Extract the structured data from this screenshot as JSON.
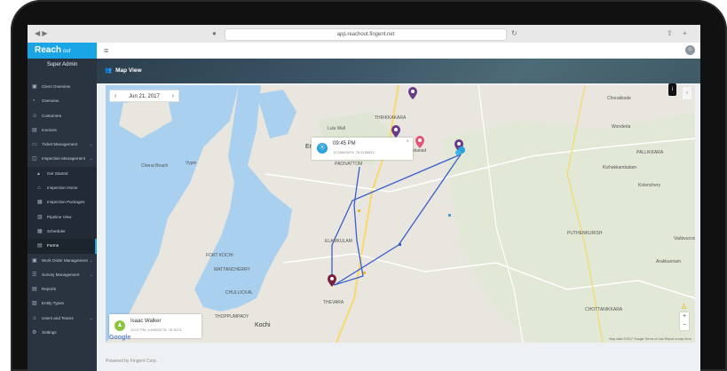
{
  "browser": {
    "url": "app.reachout.fingent.net"
  },
  "sidebar": {
    "logo": "Reach",
    "logo_sub": "out",
    "user": "Super Admin",
    "items": [
      {
        "label": "Client Overview",
        "icon": "bag-icon",
        "sub": false,
        "chev": false
      },
      {
        "label": "Overview",
        "icon": "pie-icon",
        "sub": false,
        "chev": false
      },
      {
        "label": "Customers",
        "icon": "users-icon",
        "sub": false,
        "chev": false
      },
      {
        "label": "Invoices",
        "icon": "invoice-icon",
        "sub": false,
        "chev": false
      },
      {
        "label": "Ticket Management",
        "icon": "ticket-icon",
        "sub": false,
        "chev": true
      },
      {
        "label": "Inspection Management",
        "icon": "inspection-icon",
        "sub": false,
        "chev": true
      },
      {
        "label": "Get Started",
        "icon": "rocket-icon",
        "sub": true,
        "chev": false
      },
      {
        "label": "Inspection Home",
        "icon": "home-icon",
        "sub": true,
        "chev": false
      },
      {
        "label": "Inspection Packages",
        "icon": "package-icon",
        "sub": true,
        "chev": false
      },
      {
        "label": "Pipeline View",
        "icon": "pipeline-icon",
        "sub": true,
        "chev": false
      },
      {
        "label": "Scheduler",
        "icon": "calendar-icon",
        "sub": true,
        "chev": false
      },
      {
        "label": "Forms",
        "icon": "forms-icon",
        "sub": true,
        "chev": false,
        "active": true
      },
      {
        "label": "Work Order Management",
        "icon": "workorder-icon",
        "sub": false,
        "chev": true
      },
      {
        "label": "Survey Management",
        "icon": "survey-icon",
        "sub": false,
        "chev": true
      },
      {
        "label": "Reports",
        "icon": "reports-icon",
        "sub": false,
        "chev": false
      },
      {
        "label": "Entity Types",
        "icon": "entity-icon",
        "sub": false,
        "chev": false
      },
      {
        "label": "Users and Teams",
        "icon": "team-icon",
        "sub": false,
        "chev": true
      },
      {
        "label": "Settings",
        "icon": "gear-icon",
        "sub": false,
        "chev": false
      }
    ]
  },
  "header": {
    "title": "Map View"
  },
  "map": {
    "date": "Jun 21, 2017",
    "info_window": {
      "time": "09:45 PM",
      "coords": "10.00603479, 76.3156543"
    },
    "user_card": {
      "name": "Isaac Walker",
      "detail": "10:07 PM, 9.94903776, 76.3073"
    },
    "labels": [
      {
        "text": "Ernakulam",
        "big": true
      },
      {
        "text": "PADIVATTOM",
        "big": false
      },
      {
        "text": "ELAMKULAM",
        "big": false
      },
      {
        "text": "FORT KOCHI",
        "big": false
      },
      {
        "text": "MATTANCHERRY",
        "big": false
      },
      {
        "text": "CHULLICKAL",
        "big": false
      },
      {
        "text": "THEVARA",
        "big": false
      },
      {
        "text": "THOPPUMPADY",
        "big": false
      },
      {
        "text": "Kochi",
        "big": true
      },
      {
        "text": "PALLIKKARA",
        "big": false
      },
      {
        "text": "PUTHENKURISH",
        "big": false
      },
      {
        "text": "CHOTTANIKKARA",
        "big": false
      },
      {
        "text": "Kakkanad",
        "big": false
      },
      {
        "text": "THRIKKAKARA",
        "big": false
      },
      {
        "text": "Lulu Mall",
        "big": false
      },
      {
        "text": "Vypin",
        "big": false
      },
      {
        "text": "Cherai Beach",
        "big": false
      },
      {
        "text": "Chorakkode",
        "big": false
      },
      {
        "text": "Wonderla",
        "big": false
      },
      {
        "text": "Kizhakkambalam",
        "big": false
      },
      {
        "text": "Kolenchery",
        "big": false
      },
      {
        "text": "Vadavucode",
        "big": false
      },
      {
        "text": "Arakkunnam",
        "big": false
      }
    ],
    "attribution": "Map data ©2017 Google   Terms of Use   Report a map error",
    "google": "Google"
  },
  "footer": {
    "text": "Powered by Fingent Corp."
  },
  "colors": {
    "accent": "#1aa5e6",
    "sidebar": "#2a3440",
    "route": "#3a5fcd",
    "pin_purple": "#6b3a8a",
    "pin_pink": "#e0567a",
    "pin_dark": "#7a1f3d"
  }
}
